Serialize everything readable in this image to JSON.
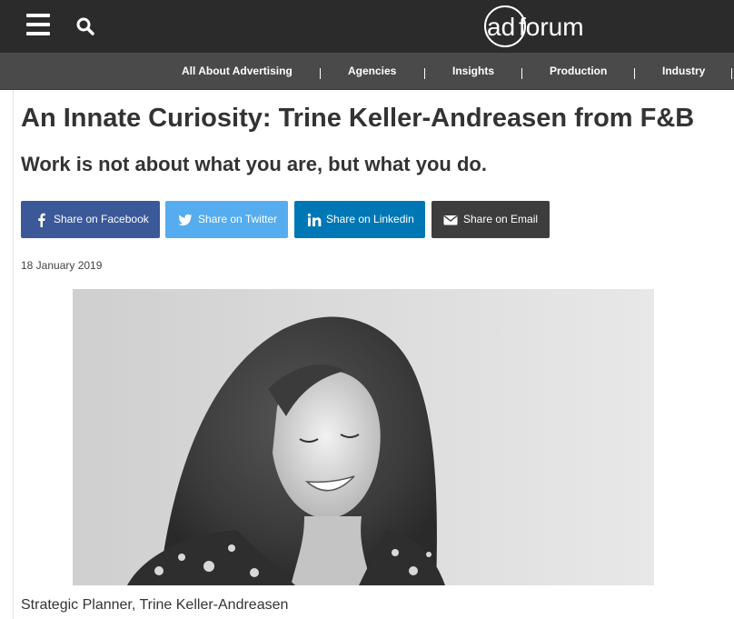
{
  "header": {
    "menu_icon": "hamburger-menu-icon",
    "search_icon": "search-icon",
    "logo": {
      "prefix": "ad",
      "suffix": "forum"
    },
    "background_color": "#2b2b2b"
  },
  "nav": {
    "items": [
      {
        "label": "All About Advertising"
      },
      {
        "label": "Agencies"
      },
      {
        "label": "Insights"
      },
      {
        "label": "Production"
      },
      {
        "label": "Industry"
      }
    ],
    "background_color": "#4a4a4a"
  },
  "article": {
    "title": "An Innate Curiosity: Trine Keller-Andreasen from F&B",
    "subtitle": "Work is not about what you are, but what you do.",
    "date": "18 January 2019",
    "caption": "Strategic Planner, Trine Keller-Andreasen"
  },
  "share": {
    "facebook": {
      "label": "Share on Facebook",
      "icon": "facebook-icon",
      "color": "#3b5998"
    },
    "twitter": {
      "label": "Share on Twitter",
      "icon": "twitter-icon",
      "color": "#55acee"
    },
    "linkedin": {
      "label": "Share on Linkedin",
      "icon": "linkedin-icon",
      "color": "#0077b5"
    },
    "email": {
      "label": "Share on Email",
      "icon": "envelope-icon",
      "color": "#3d3d3d"
    }
  }
}
